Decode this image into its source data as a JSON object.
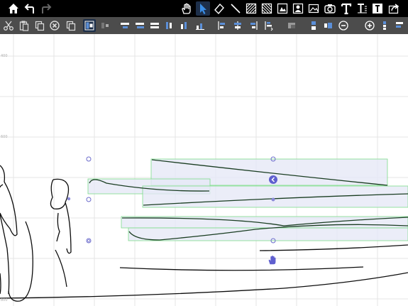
{
  "rulers": [
    "400",
    "600",
    "800"
  ],
  "toolbar": {
    "zoom": "10"
  },
  "colors": {
    "topbar": "#000000",
    "toolbar": "#4c4c4c",
    "ink": "#0c0c0c",
    "stroke_dark_green": "#1a3d22",
    "selection_fill": "#e6e8f6",
    "selection_border": "#7ddc8a",
    "handle": "#6c6ccc",
    "accent_icon": "#5b8fd8",
    "grid": "#e4e4e4"
  },
  "icons_top": [
    "home-icon",
    "undo-icon",
    "redo-icon",
    "hand-tool-icon",
    "select-arrow-icon",
    "eraser-icon",
    "line-tool-icon",
    "hatch-rect-icon",
    "hatch-shape-icon",
    "insert-shape-icon",
    "insert-portrait-icon",
    "insert-image-icon",
    "camera-icon",
    "text-tool-icon",
    "text-box-icon",
    "text-label-icon",
    "share-icon"
  ],
  "icons_toolbar": [
    "cut-icon",
    "paste-icon",
    "copy-icon",
    "delete-icon",
    "duplicate-icon",
    "group-icon",
    "ungroup-icon",
    "align-top-icon",
    "align-middle-icon",
    "align-bottom-icon",
    "align-left-icon",
    "align-center-icon",
    "align-right-icon",
    "distribute-1-icon",
    "distribute-2-icon",
    "distribute-3-icon",
    "distribute-4-icon",
    "bring-front-icon",
    "layer-1-icon",
    "layer-2-icon",
    "zoom-out-icon",
    "zoom-in-icon",
    "more-1-icon",
    "more-2-icon"
  ]
}
